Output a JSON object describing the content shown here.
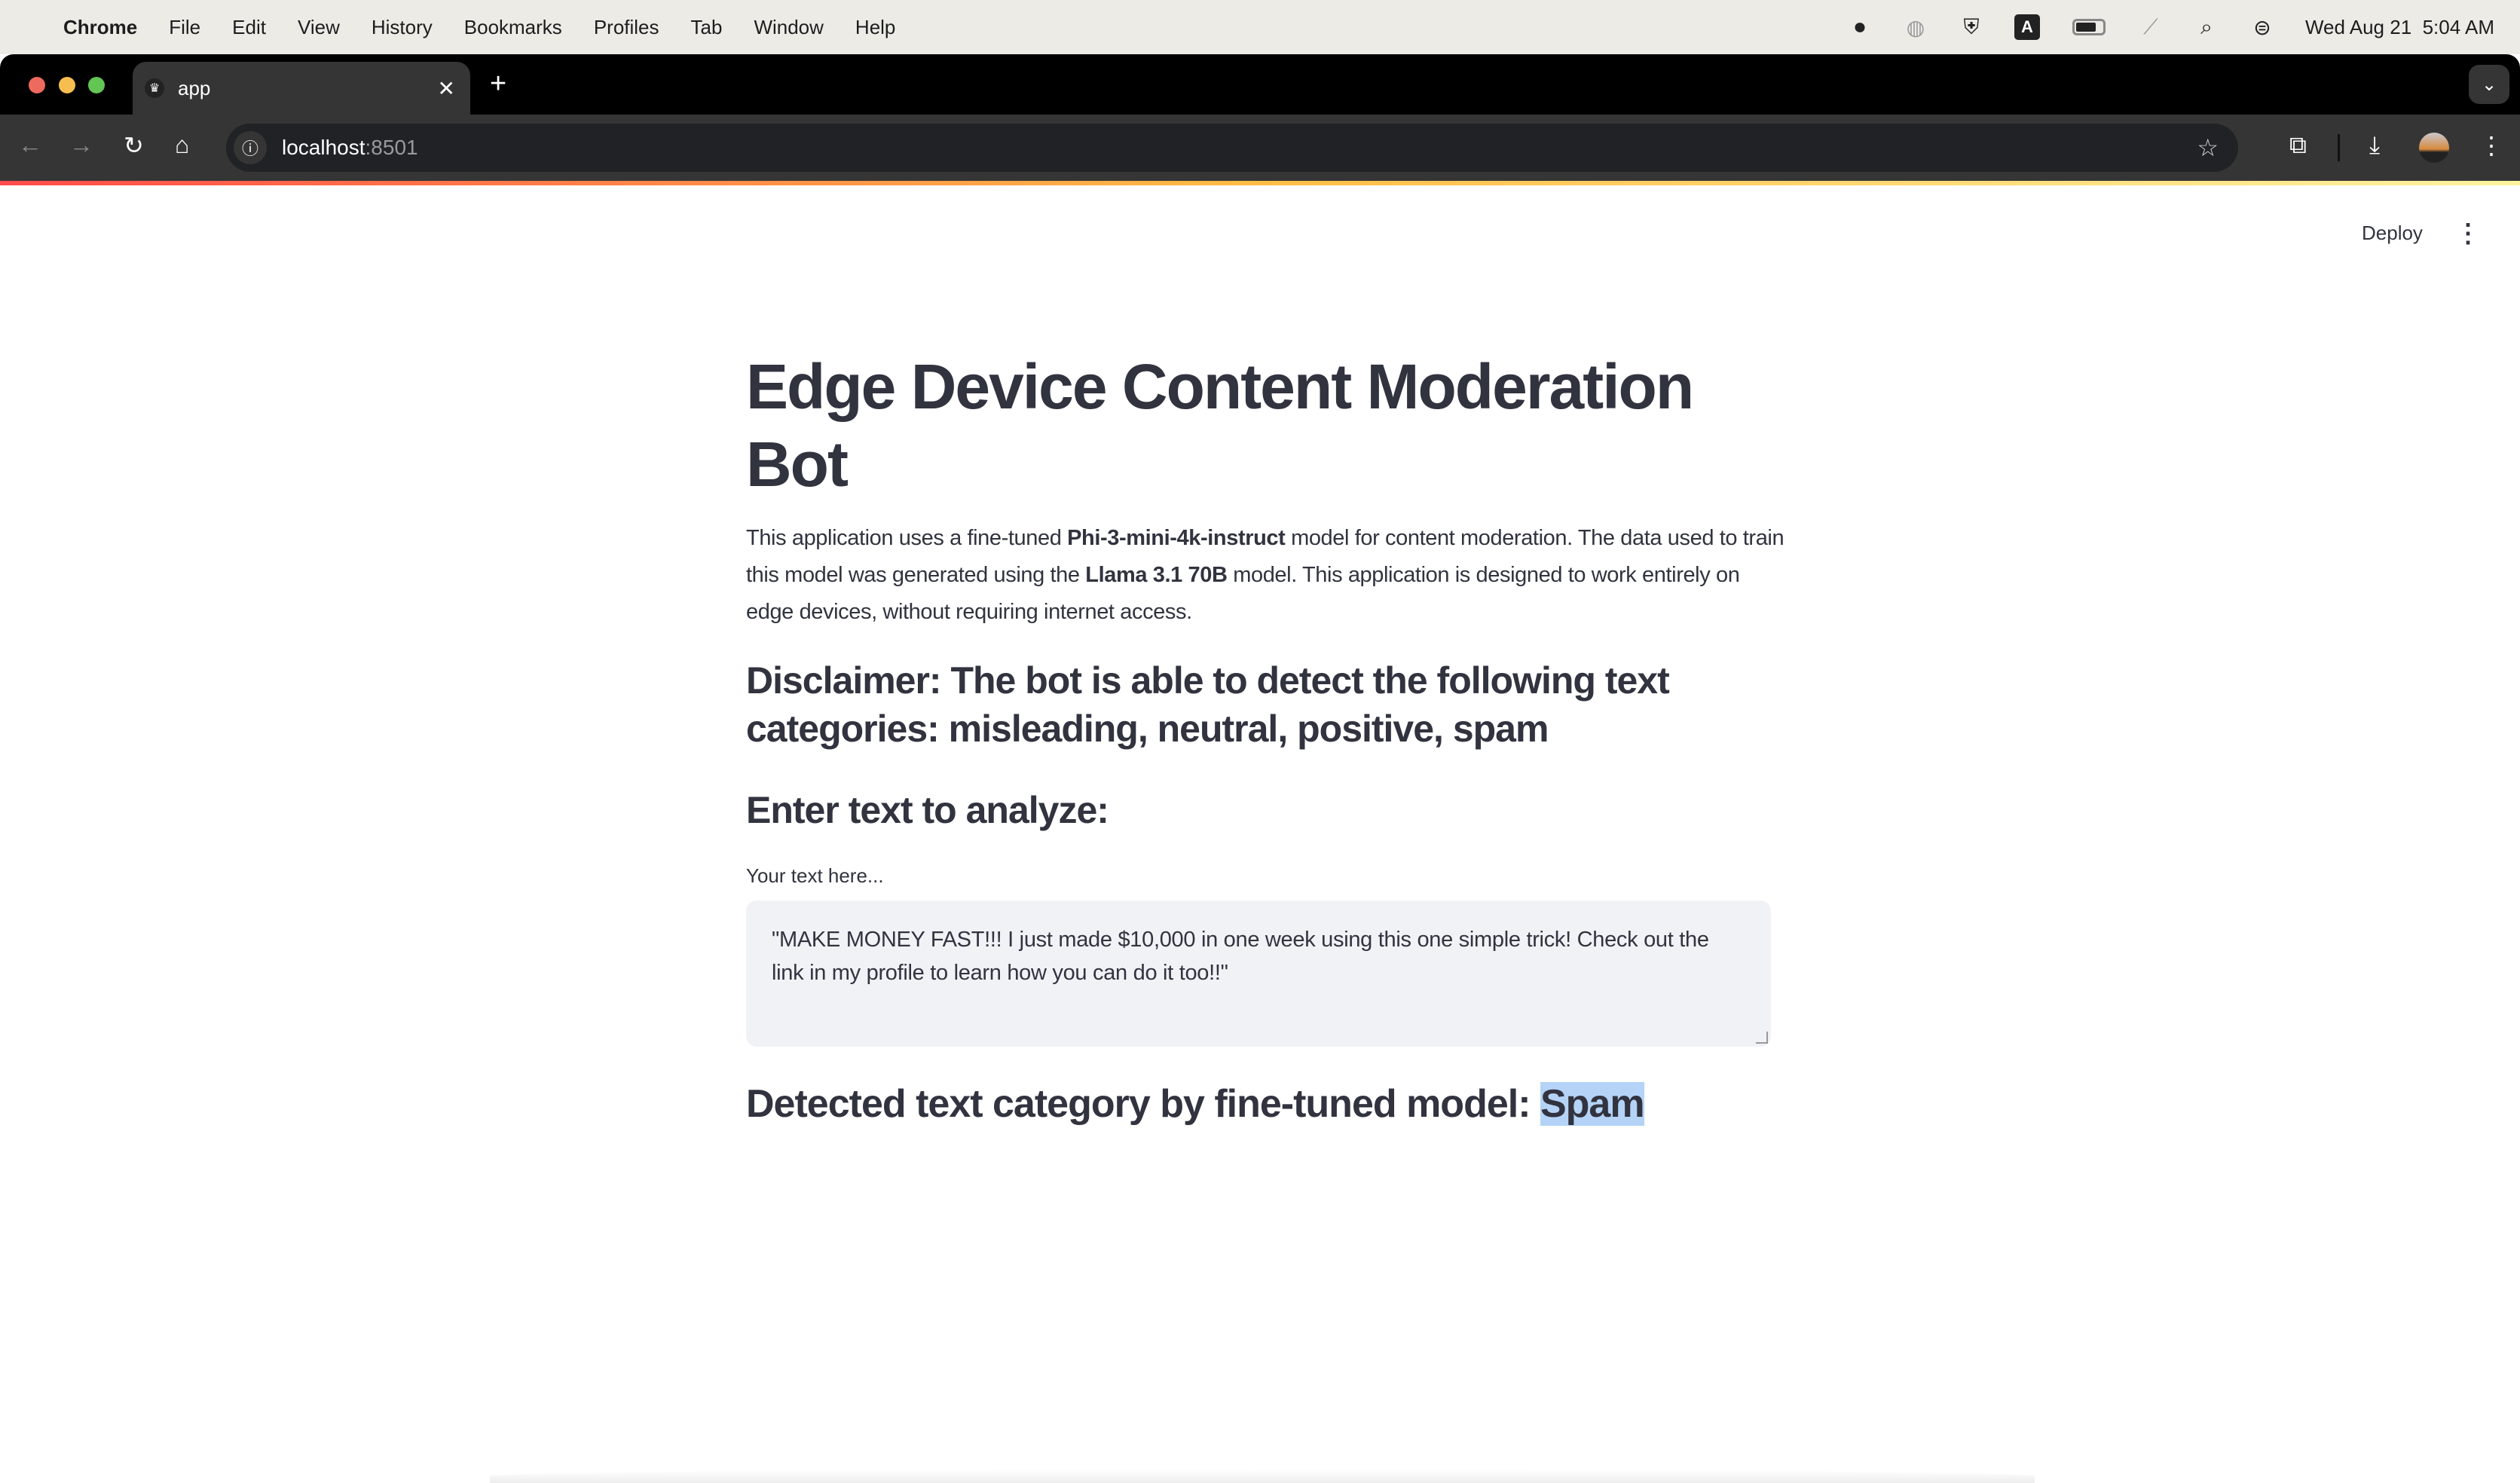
{
  "menubar": {
    "app": "Chrome",
    "items": [
      "File",
      "Edit",
      "View",
      "History",
      "Bookmarks",
      "Profiles",
      "Tab",
      "Window",
      "Help"
    ],
    "clock": "Wed Aug 21  5:04 AM"
  },
  "browser": {
    "tab_title": "app",
    "url_host": "localhost",
    "url_port": ":8501"
  },
  "header": {
    "deploy": "Deploy"
  },
  "main": {
    "title": "Edge Device Content Moderation Bot",
    "intro": {
      "p1": "This application uses a fine-tuned ",
      "b1": "Phi-3-mini-4k-instruct",
      "p2": " model for content moderation. The data used to train this model was generated using the ",
      "b2": "Llama 3.1 70B",
      "p3": " model. This application is designed to work entirely on edge devices, without requiring internet access."
    },
    "disclaimer": "Disclaimer: The bot is able to detect the following text categories: misleading, neutral, positive, spam",
    "enter_heading": "Enter text to analyze:",
    "input_label": "Your text here...",
    "input_value": "\"MAKE MONEY FAST!!! I just made $10,000 in one week using this one simple trick! Check out the link in my profile to learn how you can do it too!!\"",
    "result_prefix": "Detected text category by fine-tuned model: ",
    "result_value": "Spam"
  },
  "colors": {
    "accent_gradient": [
      "#ff4b4b",
      "#ffbd45"
    ],
    "textarea_bg": "#f0f2f6",
    "highlight": "#b4d3f7"
  }
}
